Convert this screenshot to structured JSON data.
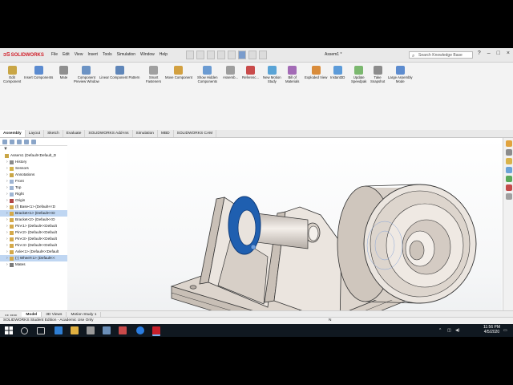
{
  "app": {
    "brand": "SOLIDWORKS",
    "document_title": "Assem1 *",
    "menus": [
      "File",
      "Edit",
      "View",
      "Insert",
      "Tools",
      "Simulation",
      "Window",
      "Help"
    ],
    "search_placeholder": "Search Knowledge Base",
    "window_controls": [
      "?",
      "–",
      "□",
      "×"
    ]
  },
  "ribbon": {
    "buttons": [
      {
        "label": "Edit\nComponent",
        "icon": "edit-component-icon",
        "color": "#c9a646"
      },
      {
        "label": "Insert Components",
        "icon": "insert-components-icon",
        "color": "#5b8bd0"
      },
      {
        "label": "Mate",
        "icon": "mate-icon",
        "color": "#8f8f8f"
      },
      {
        "label": "Component\nPreview Window",
        "icon": "component-preview-icon",
        "color": "#6c93c4"
      },
      {
        "label": "Linear Component Pattern",
        "icon": "linear-pattern-icon",
        "color": "#5f86b9"
      },
      {
        "label": "Smart\nFasteners",
        "icon": "smart-fasteners-icon",
        "color": "#a0a0a0"
      },
      {
        "label": "Move Component",
        "icon": "move-component-icon",
        "color": "#d2a040"
      },
      {
        "label": "Show Hidden\nComponents",
        "icon": "show-hidden-icon",
        "color": "#6b9bd2"
      },
      {
        "label": "Assemb...",
        "icon": "assembly-features-icon",
        "color": "#9e9e9e"
      },
      {
        "label": "Referenc...",
        "icon": "reference-geometry-icon",
        "color": "#c94b4b"
      },
      {
        "label": "New Motion\nStudy",
        "icon": "motion-study-icon",
        "color": "#5aa4d6"
      },
      {
        "label": "Bill of\nMaterials",
        "icon": "bill-of-materials-icon",
        "color": "#a36bb6"
      },
      {
        "label": "Exploded View",
        "icon": "exploded-view-icon",
        "color": "#d98c3b"
      },
      {
        "label": "Instant3D",
        "icon": "instant3d-icon",
        "color": "#5c9bd9"
      },
      {
        "label": "Update\nSpeedpak",
        "icon": "speedpak-icon",
        "color": "#7bb86f"
      },
      {
        "label": "Take\nSnapshot",
        "icon": "snapshot-icon",
        "color": "#8c8c8c"
      },
      {
        "label": "Large Assembly\nMode",
        "icon": "large-assembly-icon",
        "color": "#5d8ccf"
      }
    ]
  },
  "tabs": [
    "Assembly",
    "Layout",
    "Sketch",
    "Evaluate",
    "SOLIDWORKS Add-Ins",
    "Simulation",
    "MBD",
    "SOLIDWORKS CAM"
  ],
  "active_tab": "Assembly",
  "tree": {
    "root": "Assem1 (Default<Default_D",
    "items": [
      {
        "label": "History",
        "icon": "history-icon",
        "color": "#8a8a8a",
        "level": 1,
        "selected": false
      },
      {
        "label": "Sensors",
        "icon": "sensors-icon",
        "color": "#d3b24a",
        "level": 1,
        "selected": false
      },
      {
        "label": "Annotations",
        "icon": "annotations-icon",
        "color": "#c9a646",
        "level": 1,
        "selected": false
      },
      {
        "label": "Front",
        "icon": "plane-icon",
        "color": "#9fb5d3",
        "level": 1,
        "selected": false
      },
      {
        "label": "Top",
        "icon": "plane-icon",
        "color": "#9fb5d3",
        "level": 1,
        "selected": false
      },
      {
        "label": "Right",
        "icon": "plane-icon",
        "color": "#9fb5d3",
        "level": 1,
        "selected": false
      },
      {
        "label": "Origin",
        "icon": "origin-icon",
        "color": "#b04646",
        "level": 1,
        "selected": false
      },
      {
        "label": "(f) Base<1> (Default<<D",
        "icon": "part-icon",
        "color": "#d4a94a",
        "level": 1,
        "selected": false
      },
      {
        "label": "Bracket<1> (Default<<D",
        "icon": "part-icon",
        "color": "#d4a94a",
        "level": 1,
        "selected": true
      },
      {
        "label": "Bracket<2> (Default<<D",
        "icon": "part-icon",
        "color": "#d4a94a",
        "level": 1,
        "selected": false
      },
      {
        "label": "Pin<1> (Default<<Default",
        "icon": "part-icon",
        "color": "#d4a94a",
        "level": 1,
        "selected": false
      },
      {
        "label": "Pin<2> (Default<<Default",
        "icon": "part-icon",
        "color": "#d4a94a",
        "level": 1,
        "selected": false
      },
      {
        "label": "Pin<3> (Default<<Default",
        "icon": "part-icon",
        "color": "#d4a94a",
        "level": 1,
        "selected": false
      },
      {
        "label": "Pin<4> (Default<<Default",
        "icon": "part-icon",
        "color": "#d4a94a",
        "level": 1,
        "selected": false
      },
      {
        "label": "Axle<1> (Default<<Default",
        "icon": "part-icon",
        "color": "#d4a94a",
        "level": 1,
        "selected": false
      },
      {
        "label": "(-) Wheel<1> (Default<<",
        "icon": "part-icon",
        "color": "#d4a94a",
        "level": 1,
        "selected": true
      },
      {
        "label": "Mates",
        "icon": "mates-icon",
        "color": "#7b7b7b",
        "level": 1,
        "selected": false
      }
    ]
  },
  "bottom_tabs": [
    "Model",
    "3D Views",
    "Motion Study 1"
  ],
  "active_bottom_tab": "Model",
  "status": {
    "left": "SOLIDWORKS Student Edition - Academic Use Only",
    "mid": "N"
  },
  "taskbar": {
    "time": "11:56 PM",
    "date": "4/5/2020"
  },
  "colors": {
    "accent": "#1f5fb0",
    "selection": "#bfd6f2",
    "part": "#d9d2cb"
  }
}
